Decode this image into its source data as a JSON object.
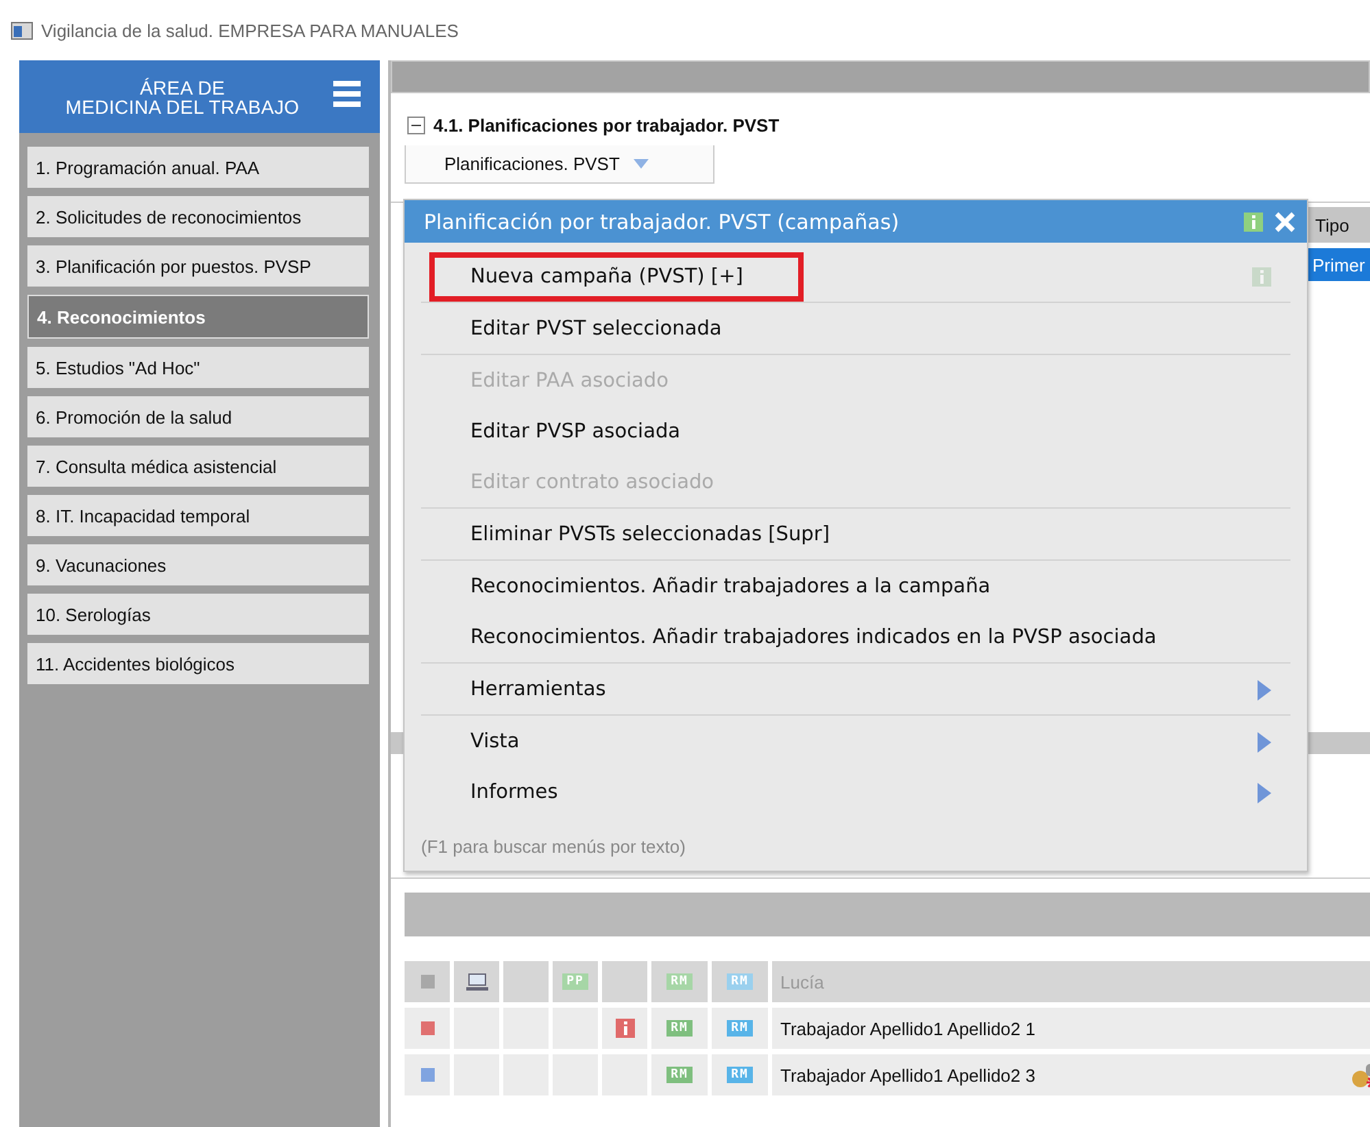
{
  "window": {
    "title": "Vigilancia de la salud.  EMPRESA PARA MANUALES"
  },
  "sidebar": {
    "heading_lines": [
      "ÁREA DE",
      "MEDICINA DEL TRABAJO"
    ],
    "items": [
      {
        "label": "1. Programación anual. PAA",
        "selected": false
      },
      {
        "label": "2. Solicitudes de reconocimientos",
        "selected": false
      },
      {
        "label": "3. Planificación por puestos. PVSP",
        "selected": false
      },
      {
        "label": "4. Reconocimientos",
        "selected": true
      },
      {
        "label": "5. Estudios \"Ad Hoc\"",
        "selected": false
      },
      {
        "label": "6. Promoción de la salud",
        "selected": false
      },
      {
        "label": "7. Consulta médica asistencial",
        "selected": false
      },
      {
        "label": "8. IT. Incapacidad temporal",
        "selected": false
      },
      {
        "label": "9. Vacunaciones",
        "selected": false
      },
      {
        "label": "10. Serologías",
        "selected": false
      },
      {
        "label": "11. Accidentes biológicos",
        "selected": false
      }
    ]
  },
  "section": {
    "title": "4.1. Planificaciones por trabajador. PVST",
    "expanded": true
  },
  "dropdown": {
    "label": "Planificaciones. PVST"
  },
  "upper_table": {
    "column_header": "Tipo",
    "cell": "Primer",
    "selected": true
  },
  "menu": {
    "title": "Planificación por trabajador. PVST (campañas)",
    "items": [
      {
        "label": "Nueva campaña (PVST)  [+]",
        "disabled": false,
        "highlighted": true,
        "info": true,
        "submenu": false,
        "separator_after": true
      },
      {
        "label": "Editar PVST seleccionada",
        "disabled": false,
        "highlighted": false,
        "info": false,
        "submenu": false,
        "separator_after": true
      },
      {
        "label": "Editar PAA asociado",
        "disabled": true,
        "highlighted": false,
        "info": false,
        "submenu": false,
        "separator_after": false
      },
      {
        "label": "Editar PVSP asociada",
        "disabled": false,
        "highlighted": false,
        "info": false,
        "submenu": false,
        "separator_after": false
      },
      {
        "label": "Editar contrato asociado",
        "disabled": true,
        "highlighted": false,
        "info": false,
        "submenu": false,
        "separator_after": true
      },
      {
        "label": "Eliminar PVSTs seleccionadas  [Supr]",
        "disabled": false,
        "highlighted": false,
        "info": false,
        "submenu": false,
        "separator_after": true
      },
      {
        "label": "Reconocimientos. Añadir trabajadores a la campaña",
        "disabled": false,
        "highlighted": false,
        "info": false,
        "submenu": false,
        "separator_after": false
      },
      {
        "label": "Reconocimientos. Añadir trabajadores indicados en la PVSP asociada",
        "disabled": false,
        "highlighted": false,
        "info": false,
        "submenu": false,
        "separator_after": true
      },
      {
        "label": "Herramientas",
        "disabled": false,
        "highlighted": false,
        "info": false,
        "submenu": true,
        "separator_after": true
      },
      {
        "label": "Vista",
        "disabled": false,
        "highlighted": false,
        "info": false,
        "submenu": true,
        "separator_after": false
      },
      {
        "label": "Informes",
        "disabled": false,
        "highlighted": false,
        "info": false,
        "submenu": true,
        "separator_after": false
      }
    ],
    "hint": "(F1 para buscar menús por texto)"
  },
  "workers": [
    {
      "color": "#a8a8a8",
      "selected": true,
      "monitor": true,
      "pp_badge": "PP",
      "info": false,
      "rm_badges": [
        "RM",
        "RM"
      ],
      "name": "Lucía",
      "alert": false
    },
    {
      "color": "#e07070",
      "selected": false,
      "monitor": false,
      "info": true,
      "rm_badges": [
        "RM",
        "RM"
      ],
      "name": "Trabajador Apellido1 Apellido2 1",
      "alert": false
    },
    {
      "color": "#80a4e0",
      "selected": false,
      "monitor": false,
      "info": false,
      "rm_badges": [
        "RM",
        "RM"
      ],
      "name": "Trabajador Apellido1 Apellido2 3",
      "alert": true
    }
  ]
}
